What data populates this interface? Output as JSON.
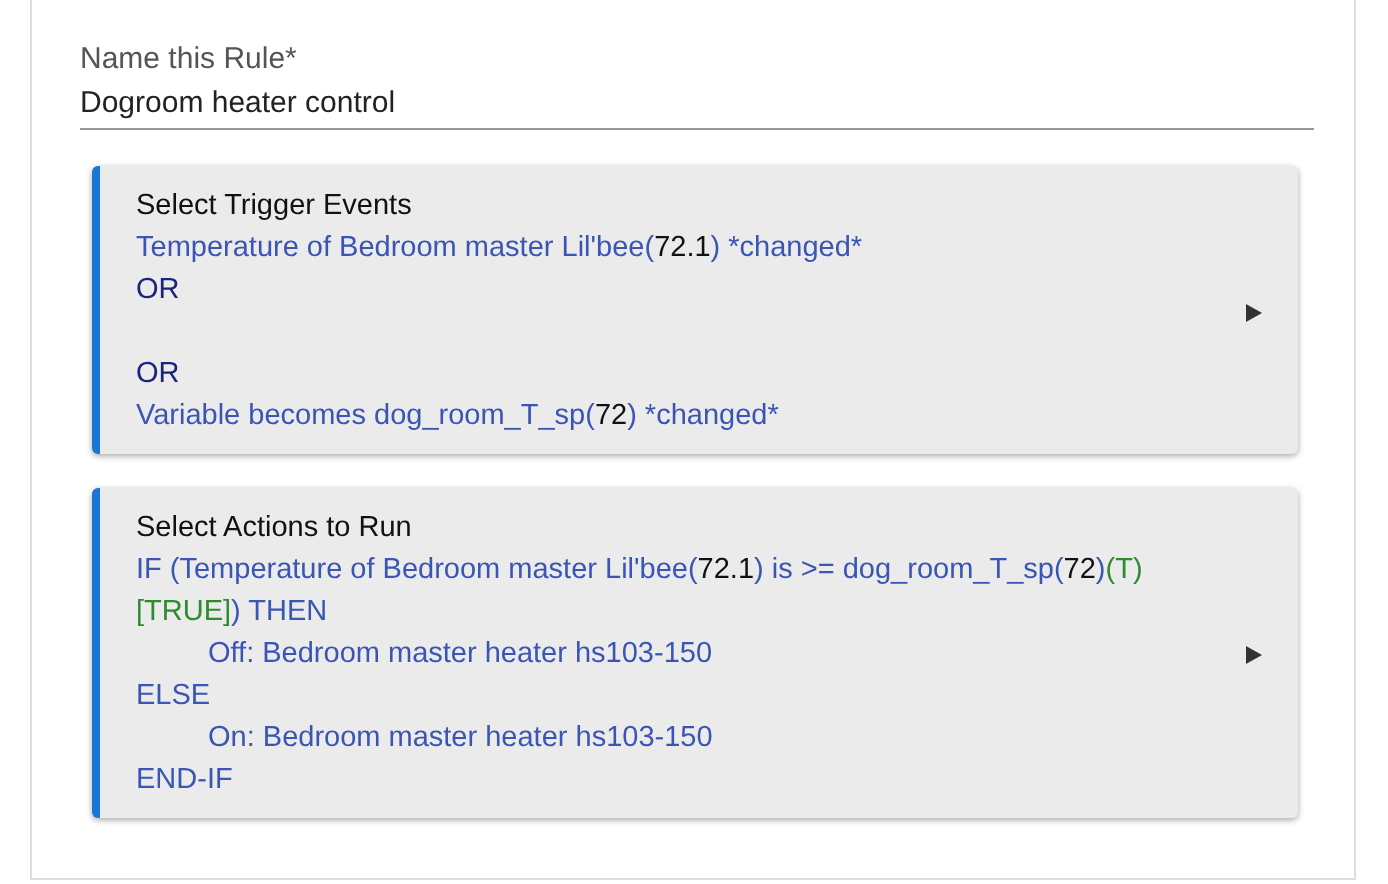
{
  "rule_name": {
    "label": "Name this Rule*",
    "value": "Dogroom heater control"
  },
  "sections": [
    {
      "title": "Select Trigger Events",
      "lines": [
        {
          "kind": "text",
          "segments": [
            {
              "kind": "link",
              "text": "Temperature of Bedroom master Lil'bee("
            },
            {
              "kind": "value",
              "text": "72.1"
            },
            {
              "kind": "link",
              "text": ") *changed*"
            }
          ]
        },
        {
          "kind": "text",
          "segments": [
            {
              "kind": "keyword",
              "text": "OR"
            }
          ]
        },
        {
          "kind": "blank"
        },
        {
          "kind": "text",
          "segments": [
            {
              "kind": "keyword",
              "text": "OR"
            }
          ]
        },
        {
          "kind": "text",
          "segments": [
            {
              "kind": "link",
              "text": "Variable becomes dog_room_T_sp("
            },
            {
              "kind": "value",
              "text": "72"
            },
            {
              "kind": "link",
              "text": ") *changed*"
            }
          ]
        }
      ]
    },
    {
      "title": "Select Actions to Run",
      "lines": [
        {
          "kind": "text",
          "segments": [
            {
              "kind": "link",
              "text": "IF (Temperature of Bedroom master Lil'bee("
            },
            {
              "kind": "value",
              "text": "72.1"
            },
            {
              "kind": "link",
              "text": ") is >= dog_room_T_sp("
            },
            {
              "kind": "value",
              "text": "72"
            },
            {
              "kind": "link",
              "text": ")"
            },
            {
              "kind": "true",
              "text": "(T)"
            }
          ]
        },
        {
          "kind": "text",
          "segments": [
            {
              "kind": "true",
              "text": "[TRUE]"
            },
            {
              "kind": "link",
              "text": ") THEN"
            }
          ],
          "children": [
            {
              "kind": "text",
              "segments": [
                {
                  "kind": "link",
                  "text": "Off: Bedroom master heater hs103-150"
                }
              ]
            }
          ]
        },
        {
          "kind": "text",
          "segments": [
            {
              "kind": "link",
              "text": "ELSE"
            }
          ],
          "children": [
            {
              "kind": "text",
              "segments": [
                {
                  "kind": "link",
                  "text": "On: Bedroom master heater hs103-150"
                }
              ]
            }
          ]
        },
        {
          "kind": "text",
          "segments": [
            {
              "kind": "link",
              "text": "END-IF"
            }
          ]
        }
      ]
    }
  ]
}
